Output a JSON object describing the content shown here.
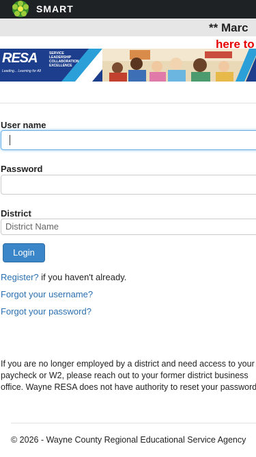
{
  "app": {
    "name": "SMART"
  },
  "notice": {
    "line1": "** Marc",
    "line2": "here to"
  },
  "banner": {
    "logo": "RESA",
    "tagline": "Leading... Learning for All",
    "values": [
      "SERVICE",
      "LEADERSHIP",
      "COLLABORATION",
      "EXCELLENCE"
    ]
  },
  "form": {
    "username_label": "User name",
    "password_label": "Password",
    "district_label": "District",
    "district_placeholder": "District Name",
    "login_label": "Login"
  },
  "links": {
    "register_link": "Register?",
    "register_suffix": " if you haven't already.",
    "forgot_username": "Forgot your username?",
    "forgot_password": "Forgot your password?"
  },
  "info": "If you are no longer employed by a district and need access to your paycheck or W2, please reach out to your former district business office. Wayne RESA does not have authority to reset your password.",
  "footer": "© 2026 - Wayne County Regional Educational Service Agency",
  "colors": {
    "topbar": "#1f2224",
    "accent": "#3b85c9",
    "link": "#2a6fb1",
    "notice_red": "#e60000"
  }
}
